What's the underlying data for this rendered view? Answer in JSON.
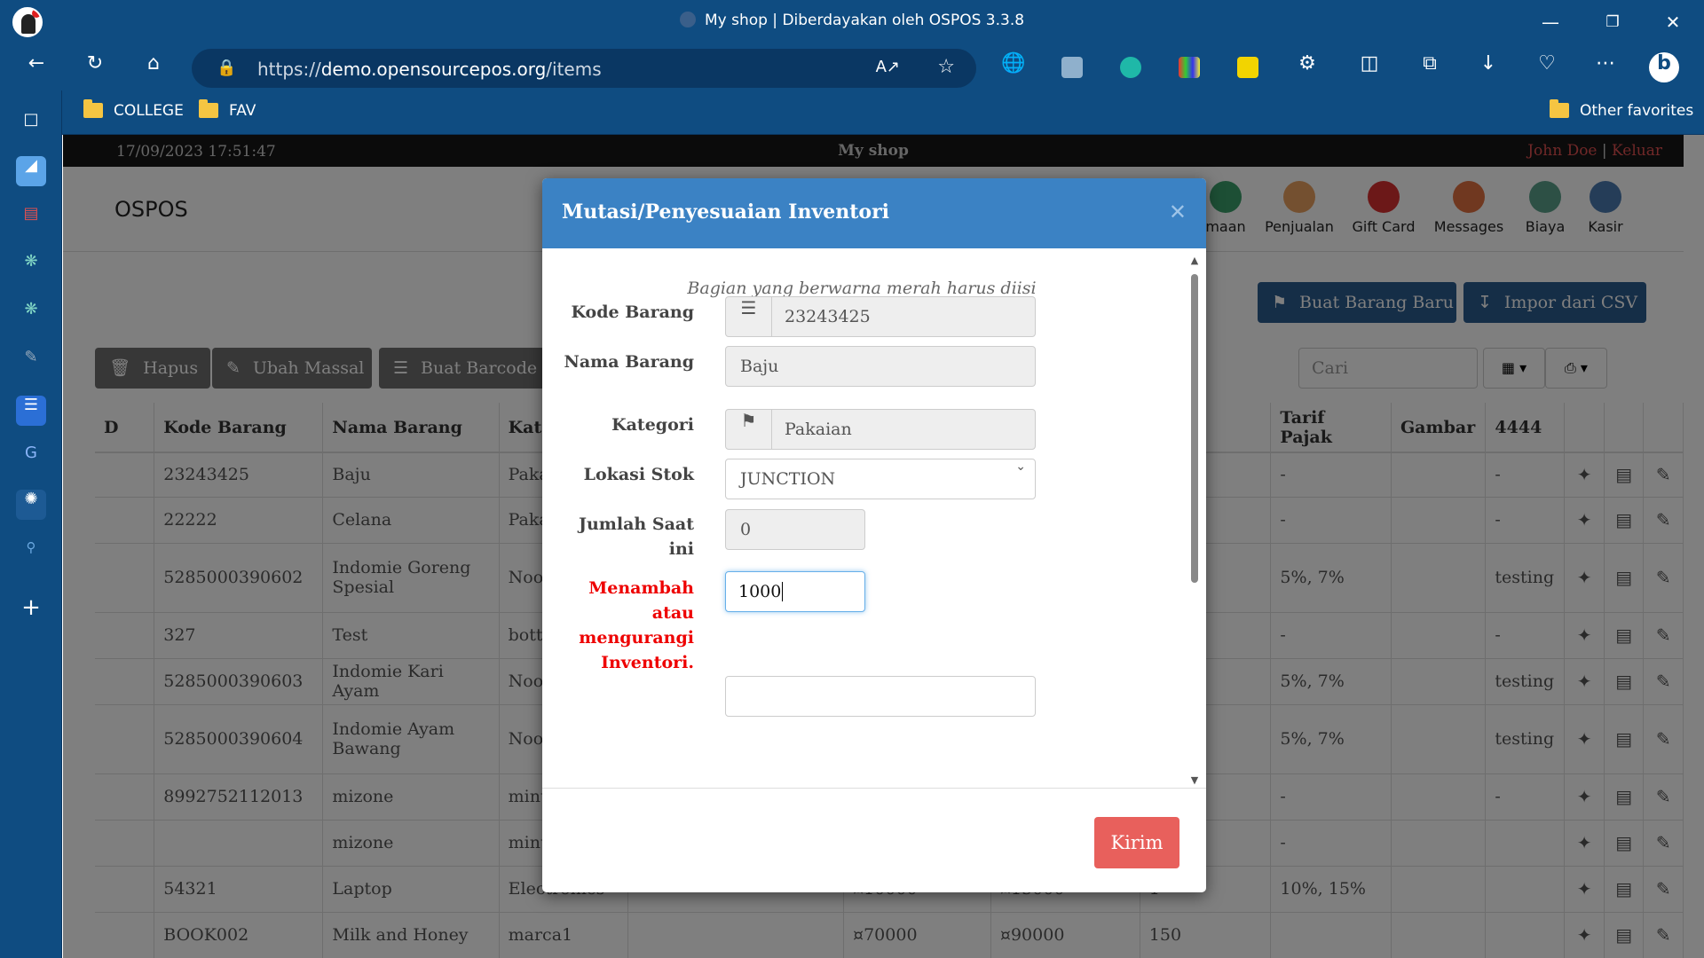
{
  "browser": {
    "window_title": "My shop | Diberdayakan oleh OSPOS 3.3.8",
    "url_prefix": "https://",
    "url_domain": "demo.opensourcepos.org",
    "url_path": "/items",
    "bookmarks": [
      "COLLEGE",
      "FAV"
    ],
    "other_favorites": "Other favorites"
  },
  "app": {
    "datetime": "17/09/2023 17:51:47",
    "shop_name": "My shop",
    "user": "John Doe",
    "separator": "|",
    "logout": "Keluar",
    "brand": "OSPOS",
    "nav": [
      {
        "label": "maan",
        "color": "#3a9e6a"
      },
      {
        "label": "Penjualan",
        "color": "#e8a060"
      },
      {
        "label": "Gift Card",
        "color": "#d93030"
      },
      {
        "label": "Messages",
        "color": "#e07040"
      },
      {
        "label": "Biaya",
        "color": "#5aa08a"
      },
      {
        "label": "Kasir",
        "color": "#4a7ab0"
      }
    ]
  },
  "toolbar": {
    "delete": "Hapus",
    "bulk_edit": "Ubah Massal",
    "barcode": "Buat Barcode",
    "new_item": "Buat Barang Baru",
    "import_csv": "Impor dari CSV",
    "search_placeholder": "Cari"
  },
  "table": {
    "headers": [
      "D",
      "Kode Barang",
      "Nama Barang",
      "Kate",
      "",
      "",
      "",
      "",
      "Tarif Pajak",
      "Gambar",
      "4444"
    ],
    "rows": [
      {
        "code": "23243425",
        "name": "Baju",
        "cat": "Paka",
        "c5": "",
        "c6": "",
        "c7": "",
        "c8": "",
        "tax": "-",
        "img": "",
        "x": "-"
      },
      {
        "code": "22222",
        "name": "Celana",
        "cat": "Paka",
        "c5": "",
        "c6": "",
        "c7": "",
        "c8": "",
        "tax": "-",
        "img": "",
        "x": "-"
      },
      {
        "code": "5285000390602",
        "name": "Indomie Goreng Spesial",
        "cat": "Nood",
        "c5": "",
        "c6": "",
        "c7": "",
        "c8": "",
        "tax": "5%, 7%",
        "img": "",
        "x": "testing"
      },
      {
        "code": "327",
        "name": "Test",
        "cat": "bottl",
        "c5": "",
        "c6": "",
        "c7": "",
        "c8": "",
        "tax": "-",
        "img": "",
        "x": "-"
      },
      {
        "code": "5285000390603",
        "name": "Indomie Kari Ayam",
        "cat": "Nood",
        "c5": "",
        "c6": "",
        "c7": "",
        "c8": "",
        "tax": "5%, 7%",
        "img": "",
        "x": "testing"
      },
      {
        "code": "5285000390604",
        "name": "Indomie Ayam Bawang",
        "cat": "Nood",
        "c5": "",
        "c6": "",
        "c7": "",
        "c8": "",
        "tax": "5%, 7%",
        "img": "",
        "x": "testing"
      },
      {
        "code": "8992752112013",
        "name": "mizone",
        "cat": "minu",
        "c5": "",
        "c6": "",
        "c7": "",
        "c8": "",
        "tax": "-",
        "img": "",
        "x": "-"
      },
      {
        "code": "",
        "name": "mizone",
        "cat": "minu",
        "c5": "",
        "c6": "",
        "c7": "",
        "c8": "",
        "tax": "-",
        "img": "",
        "x": ""
      },
      {
        "code": "54321",
        "name": "Laptop",
        "cat": "Electronics",
        "c5": "",
        "c6": "¤10000",
        "c7": "¤15000",
        "c8": "1",
        "tax": "10%, 15%",
        "img": "",
        "x": ""
      },
      {
        "code": "BOOK002",
        "name": "Milk and Honey",
        "cat": "marca1",
        "c5": "",
        "c6": "¤70000",
        "c7": "¤90000",
        "c8": "150",
        "tax": "",
        "img": "",
        "x": ""
      }
    ]
  },
  "modal": {
    "title": "Mutasi/Penyesuaian Inventori",
    "note": "Bagian yang berwarna merah harus diisi",
    "fields": {
      "item_code_label": "Kode Barang",
      "item_code": "23243425",
      "item_name_label": "Nama Barang",
      "item_name": "Baju",
      "category_label": "Kategori",
      "category": "Pakaian",
      "location_label": "Lokasi Stok",
      "location": "JUNCTION",
      "current_qty_label": "Jumlah Saat ini",
      "current_qty": "0",
      "adjust_label": "Menambah atau mengurangi Inventori.",
      "adjust_value": "1000"
    },
    "submit": "Kirim"
  }
}
